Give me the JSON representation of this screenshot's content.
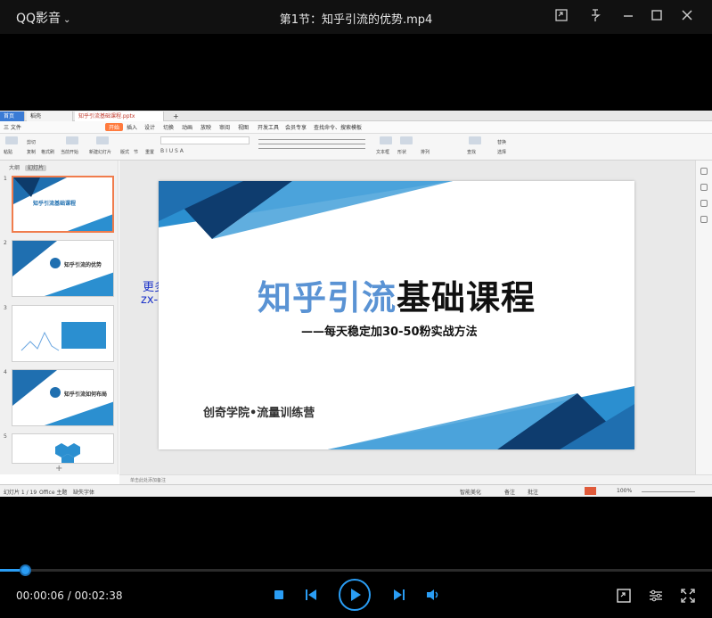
{
  "player": {
    "app_name": "QQ影音",
    "video_title": "第1节：知乎引流的优势.mp4",
    "current_time": "00:00:06",
    "total_time": "00:02:38",
    "time_separator": " / ",
    "progress_fraction": 0.038,
    "accent_color": "#2a9df4"
  },
  "wps": {
    "tabs": [
      "首页",
      "稻壳",
      "知乎引流基础课程.pptx"
    ],
    "menus": [
      "三 文件",
      "开始",
      "插入",
      "设计",
      "切换",
      "动画",
      "放映",
      "审阅",
      "视图",
      "开发工具",
      "会员专享",
      "查找命令、搜索模板"
    ],
    "ribbon": [
      "粘贴",
      "剪切",
      "复制",
      "格式刷",
      "当前开始",
      "新建幻灯片",
      "版式",
      "节",
      "重置",
      "文本框",
      "形状",
      "排列",
      "查找",
      "替换",
      "选择"
    ],
    "thumb_header": [
      "大纲",
      "幻灯片"
    ],
    "thumbs": [
      {
        "num": "1",
        "title": "知乎引流基础课程"
      },
      {
        "num": "2",
        "title": "知乎引流的优势"
      },
      {
        "num": "3",
        "title": ""
      },
      {
        "num": "4",
        "title": "知乎引流如何布局"
      },
      {
        "num": "5",
        "title": ""
      }
    ],
    "notes_placeholder": "单击此处添加备注",
    "status": [
      "幻灯片 1 / 19",
      "Office 主题",
      "缺失字体",
      "智能美化",
      "备注",
      "批注",
      "100%"
    ],
    "slide": {
      "title_blue": "知乎引流",
      "title_dark": "基础课程",
      "subtitle": "——每天稳定加30-50粉实战方法",
      "org": "创奇学院•流量训练营"
    },
    "watermark_line1": "更多课程",
    "watermark_line2": "zx-cc.net"
  }
}
